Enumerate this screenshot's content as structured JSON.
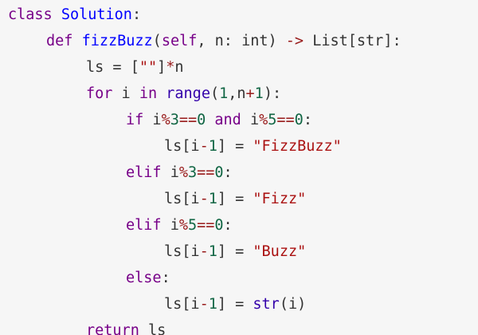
{
  "colors": {
    "background": "#f6f6f6",
    "keyword": "#770088",
    "definition": "#0000ff",
    "number": "#116644",
    "string": "#aa1111",
    "operator": "#981a1a",
    "builtin": "#3300aa",
    "text": "#333333"
  },
  "code": {
    "lines": [
      {
        "indent": 0,
        "tokens": [
          {
            "t": "class",
            "c": "kw"
          },
          {
            "t": " ",
            "c": "pun"
          },
          {
            "t": "Solution",
            "c": "def"
          },
          {
            "t": ":",
            "c": "pun"
          }
        ]
      },
      {
        "indent": 1,
        "tokens": [
          {
            "t": "def",
            "c": "kw"
          },
          {
            "t": " ",
            "c": "pun"
          },
          {
            "t": "fizzBuzz",
            "c": "def"
          },
          {
            "t": "(",
            "c": "pun"
          },
          {
            "t": "self",
            "c": "kw2"
          },
          {
            "t": ", n: ",
            "c": "pun"
          },
          {
            "t": "int",
            "c": "typ"
          },
          {
            "t": ") ",
            "c": "pun"
          },
          {
            "t": "->",
            "c": "op"
          },
          {
            "t": " List[",
            "c": "pun"
          },
          {
            "t": "str",
            "c": "typ"
          },
          {
            "t": "]:",
            "c": "pun"
          }
        ]
      },
      {
        "indent": 2,
        "tokens": [
          {
            "t": "ls",
            "c": "var"
          },
          {
            "t": " = [",
            "c": "pun"
          },
          {
            "t": "\"\"",
            "c": "str"
          },
          {
            "t": "]",
            "c": "pun"
          },
          {
            "t": "*",
            "c": "op"
          },
          {
            "t": "n",
            "c": "var"
          }
        ]
      },
      {
        "indent": 2,
        "tokens": [
          {
            "t": "for",
            "c": "kw"
          },
          {
            "t": " i ",
            "c": "pun"
          },
          {
            "t": "in",
            "c": "kw"
          },
          {
            "t": " ",
            "c": "pun"
          },
          {
            "t": "range",
            "c": "builtin"
          },
          {
            "t": "(",
            "c": "pun"
          },
          {
            "t": "1",
            "c": "num"
          },
          {
            "t": ",n",
            "c": "pun"
          },
          {
            "t": "+",
            "c": "op"
          },
          {
            "t": "1",
            "c": "num"
          },
          {
            "t": "):",
            "c": "pun"
          }
        ]
      },
      {
        "indent": 3,
        "tokens": [
          {
            "t": "if",
            "c": "kw"
          },
          {
            "t": " i",
            "c": "pun"
          },
          {
            "t": "%",
            "c": "op"
          },
          {
            "t": "3",
            "c": "num"
          },
          {
            "t": "==",
            "c": "op"
          },
          {
            "t": "0",
            "c": "num"
          },
          {
            "t": " ",
            "c": "pun"
          },
          {
            "t": "and",
            "c": "kw"
          },
          {
            "t": " i",
            "c": "pun"
          },
          {
            "t": "%",
            "c": "op"
          },
          {
            "t": "5",
            "c": "num"
          },
          {
            "t": "==",
            "c": "op"
          },
          {
            "t": "0",
            "c": "num"
          },
          {
            "t": ":",
            "c": "pun"
          }
        ]
      },
      {
        "indent": 4,
        "tokens": [
          {
            "t": "ls[i",
            "c": "pun"
          },
          {
            "t": "-",
            "c": "op"
          },
          {
            "t": "1",
            "c": "num"
          },
          {
            "t": "] = ",
            "c": "pun"
          },
          {
            "t": "\"FizzBuzz\"",
            "c": "str"
          }
        ]
      },
      {
        "indent": 3,
        "tokens": [
          {
            "t": "elif",
            "c": "kw"
          },
          {
            "t": " i",
            "c": "pun"
          },
          {
            "t": "%",
            "c": "op"
          },
          {
            "t": "3",
            "c": "num"
          },
          {
            "t": "==",
            "c": "op"
          },
          {
            "t": "0",
            "c": "num"
          },
          {
            "t": ":",
            "c": "pun"
          }
        ]
      },
      {
        "indent": 4,
        "tokens": [
          {
            "t": "ls[i",
            "c": "pun"
          },
          {
            "t": "-",
            "c": "op"
          },
          {
            "t": "1",
            "c": "num"
          },
          {
            "t": "] = ",
            "c": "pun"
          },
          {
            "t": "\"Fizz\"",
            "c": "str"
          }
        ]
      },
      {
        "indent": 3,
        "tokens": [
          {
            "t": "elif",
            "c": "kw"
          },
          {
            "t": " i",
            "c": "pun"
          },
          {
            "t": "%",
            "c": "op"
          },
          {
            "t": "5",
            "c": "num"
          },
          {
            "t": "==",
            "c": "op"
          },
          {
            "t": "0",
            "c": "num"
          },
          {
            "t": ":",
            "c": "pun"
          }
        ]
      },
      {
        "indent": 4,
        "tokens": [
          {
            "t": "ls[i",
            "c": "pun"
          },
          {
            "t": "-",
            "c": "op"
          },
          {
            "t": "1",
            "c": "num"
          },
          {
            "t": "] = ",
            "c": "pun"
          },
          {
            "t": "\"Buzz\"",
            "c": "str"
          }
        ]
      },
      {
        "indent": 3,
        "tokens": [
          {
            "t": "else",
            "c": "kw"
          },
          {
            "t": ":",
            "c": "pun"
          }
        ]
      },
      {
        "indent": 4,
        "tokens": [
          {
            "t": "ls[i",
            "c": "pun"
          },
          {
            "t": "-",
            "c": "op"
          },
          {
            "t": "1",
            "c": "num"
          },
          {
            "t": "] = ",
            "c": "pun"
          },
          {
            "t": "str",
            "c": "builtin"
          },
          {
            "t": "(i)",
            "c": "pun"
          }
        ]
      },
      {
        "indent": 2,
        "tokens": [
          {
            "t": "return",
            "c": "kw"
          },
          {
            "t": " ls",
            "c": "pun"
          }
        ]
      }
    ]
  }
}
